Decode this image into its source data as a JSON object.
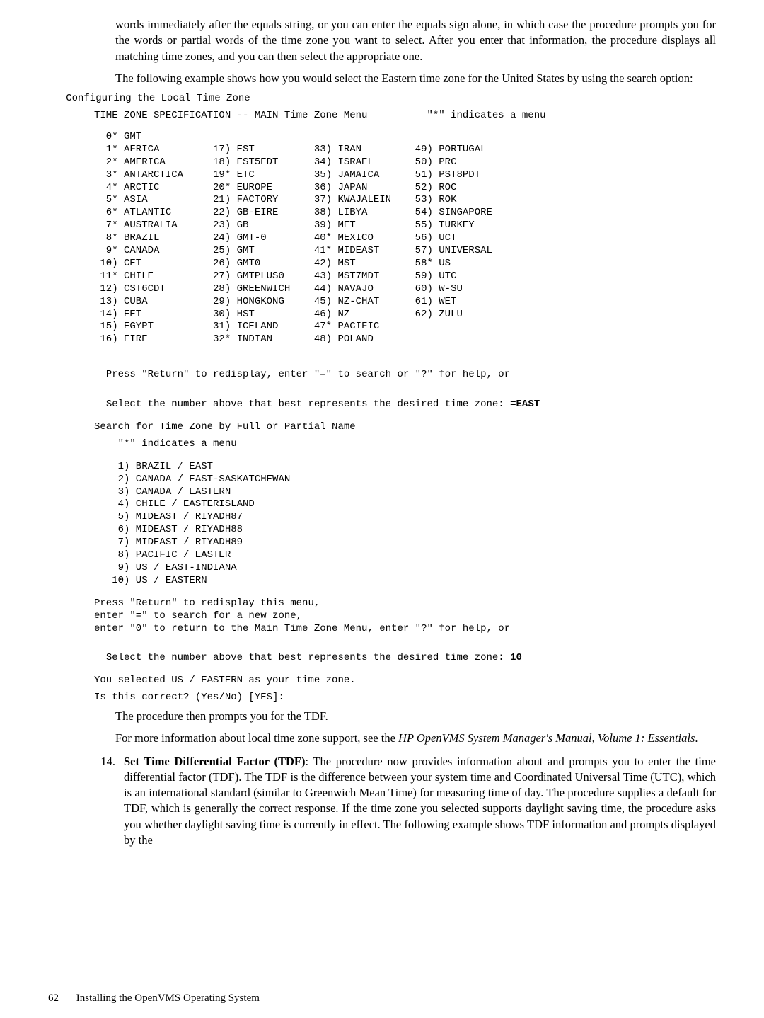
{
  "intro_p1": "words immediately after the equals string, or you can enter the equals sign alone, in which case the procedure prompts you for the words or partial words of the time zone you want to select. After you enter that information, the procedure displays all matching time zones, and you can then select the appropriate one.",
  "intro_p2": "The following example shows how you would select the Eastern time zone for the United States by using the search option:",
  "tz_conf_line": "   Configuring the Local Time Zone",
  "tz_header": "TIME ZONE SPECIFICATION -- MAIN Time Zone Menu          \"*\" indicates a menu",
  "tz_cols": [
    [
      "  0* GMT",
      "",
      "",
      ""
    ],
    [
      "  1* AFRICA",
      "17) EST",
      "33) IRAN",
      "49) PORTUGAL"
    ],
    [
      "  2* AMERICA",
      "18) EST5EDT",
      "34) ISRAEL",
      "50) PRC"
    ],
    [
      "  3* ANTARCTICA",
      "19* ETC",
      "35) JAMAICA",
      "51) PST8PDT"
    ],
    [
      "  4* ARCTIC",
      "20* EUROPE",
      "36) JAPAN",
      "52) ROC"
    ],
    [
      "  5* ASIA",
      "21) FACTORY",
      "37) KWAJALEIN",
      "53) ROK"
    ],
    [
      "  6* ATLANTIC",
      "22) GB-EIRE",
      "38) LIBYA",
      "54) SINGAPORE"
    ],
    [
      "  7* AUSTRALIA",
      "23) GB",
      "39) MET",
      "55) TURKEY"
    ],
    [
      "  8* BRAZIL",
      "24) GMT-0",
      "40* MEXICO",
      "56) UCT"
    ],
    [
      "  9* CANADA",
      "25) GMT",
      "41* MIDEAST",
      "57) UNIVERSAL"
    ],
    [
      " 10) CET",
      "26) GMT0",
      "42) MST",
      "58* US"
    ],
    [
      " 11* CHILE",
      "27) GMTPLUS0",
      "43) MST7MDT",
      "59) UTC"
    ],
    [
      " 12) CST6CDT",
      "28) GREENWICH",
      "44) NAVAJO",
      "60) W-SU"
    ],
    [
      " 13) CUBA",
      "29) HONGKONG",
      "45) NZ-CHAT",
      "61) WET"
    ],
    [
      " 14) EET",
      "30) HST",
      "46) NZ",
      "62) ZULU"
    ],
    [
      " 15) EGYPT",
      "31) ICELAND",
      "47* PACIFIC",
      ""
    ],
    [
      " 16) EIRE",
      "32* INDIAN",
      "48) POLAND",
      ""
    ]
  ],
  "press_return_1a": "Press \"Return\" to redisplay, enter \"=\" to search or \"?\" for help, or",
  "press_return_1b": "Select the number above that best represents the desired time zone: ",
  "input_east": "=EAST",
  "search_header": "Search for Time Zone by Full or Partial Name",
  "star_note": "    \"*\" indicates a menu",
  "search_list": [
    "    1) BRAZIL / EAST",
    "    2) CANADA / EAST-SASKATCHEWAN",
    "    3) CANADA / EASTERN",
    "    4) CHILE / EASTERISLAND",
    "    5) MIDEAST / RIYADH87",
    "    6) MIDEAST / RIYADH88",
    "    7) MIDEAST / RIYADH89",
    "    8) PACIFIC / EASTER",
    "    9) US / EAST-INDIANA",
    "   10) US / EASTERN"
  ],
  "press_block2": [
    "Press \"Return\" to redisplay this menu,",
    "enter \"=\" to search for a new zone,",
    "enter \"0\" to return to the Main Time Zone Menu, enter \"?\" for help, or"
  ],
  "press_block2_last": "Select the number above that best represents the desired time zone: ",
  "input_10": "10",
  "confirm_1": "You selected US / EASTERN as your time zone.",
  "confirm_2": "Is this correct? (Yes/No) [YES]:",
  "proc_tdf": "The procedure then prompts you for the TDF.",
  "more_info_a": "For more information about local time zone support, see the ",
  "more_info_title": "HP OpenVMS System Manager's Manual, Volume 1: Essentials",
  "more_info_b": ".",
  "step_num": "14.",
  "step_bold": "Set Time Differential Factor (TDF)",
  "step_text": ": The procedure now provides information about and prompts you to enter the time differential factor (TDF). The TDF is the difference between your system time and Coordinated Universal Time (UTC), which is an international standard (similar to Greenwich Mean Time) for measuring time of day. The procedure supplies a default for TDF, which is generally the correct response. If the time zone you selected supports daylight saving time, the procedure asks you whether daylight saving time is currently in effect. The following example shows TDF information and prompts displayed by the",
  "footer_page": "62",
  "footer_title": "Installing the OpenVMS Operating System"
}
